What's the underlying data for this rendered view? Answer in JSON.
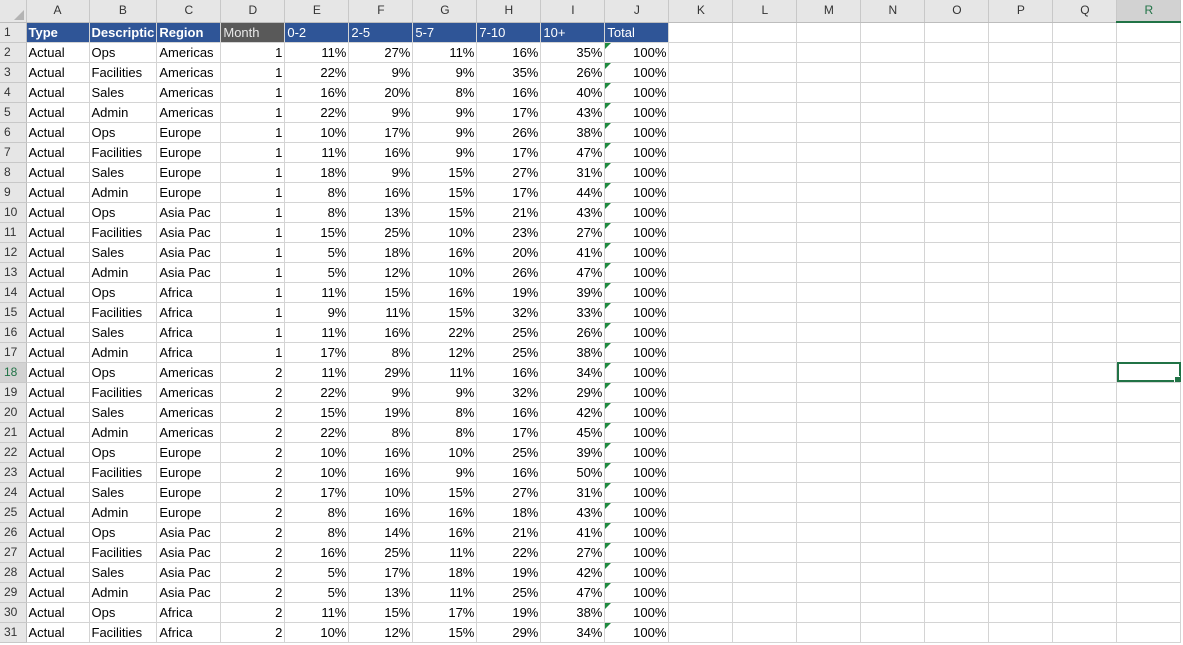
{
  "columns": [
    "A",
    "B",
    "C",
    "D",
    "E",
    "F",
    "G",
    "H",
    "I",
    "J",
    "K",
    "L",
    "M",
    "N",
    "O",
    "P",
    "Q",
    "R"
  ],
  "active_column": "R",
  "active_row": 18,
  "header_row": {
    "type": "Type",
    "description": "Descriptic",
    "region": "Region",
    "month": "Month",
    "b1": "0-2",
    "b2": "2-5",
    "b3": "5-7",
    "b4": "7-10",
    "b5": "10+",
    "total": "Total"
  },
  "rows": [
    {
      "n": "2",
      "type": "Actual",
      "desc": "Ops",
      "region": "Americas",
      "month": "1",
      "b1": "11%",
      "b2": "27%",
      "b3": "11%",
      "b4": "16%",
      "b5": "35%",
      "total": "100%"
    },
    {
      "n": "3",
      "type": "Actual",
      "desc": "Facilities",
      "region": "Americas",
      "month": "1",
      "b1": "22%",
      "b2": "9%",
      "b3": "9%",
      "b4": "35%",
      "b5": "26%",
      "total": "100%"
    },
    {
      "n": "4",
      "type": "Actual",
      "desc": "Sales",
      "region": "Americas",
      "month": "1",
      "b1": "16%",
      "b2": "20%",
      "b3": "8%",
      "b4": "16%",
      "b5": "40%",
      "total": "100%"
    },
    {
      "n": "5",
      "type": "Actual",
      "desc": "Admin",
      "region": "Americas",
      "month": "1",
      "b1": "22%",
      "b2": "9%",
      "b3": "9%",
      "b4": "17%",
      "b5": "43%",
      "total": "100%"
    },
    {
      "n": "6",
      "type": "Actual",
      "desc": "Ops",
      "region": "Europe",
      "month": "1",
      "b1": "10%",
      "b2": "17%",
      "b3": "9%",
      "b4": "26%",
      "b5": "38%",
      "total": "100%"
    },
    {
      "n": "7",
      "type": "Actual",
      "desc": "Facilities",
      "region": "Europe",
      "month": "1",
      "b1": "11%",
      "b2": "16%",
      "b3": "9%",
      "b4": "17%",
      "b5": "47%",
      "total": "100%"
    },
    {
      "n": "8",
      "type": "Actual",
      "desc": "Sales",
      "region": "Europe",
      "month": "1",
      "b1": "18%",
      "b2": "9%",
      "b3": "15%",
      "b4": "27%",
      "b5": "31%",
      "total": "100%"
    },
    {
      "n": "9",
      "type": "Actual",
      "desc": "Admin",
      "region": "Europe",
      "month": "1",
      "b1": "8%",
      "b2": "16%",
      "b3": "15%",
      "b4": "17%",
      "b5": "44%",
      "total": "100%"
    },
    {
      "n": "10",
      "type": "Actual",
      "desc": "Ops",
      "region": "Asia Pac",
      "month": "1",
      "b1": "8%",
      "b2": "13%",
      "b3": "15%",
      "b4": "21%",
      "b5": "43%",
      "total": "100%"
    },
    {
      "n": "11",
      "type": "Actual",
      "desc": "Facilities",
      "region": "Asia Pac",
      "month": "1",
      "b1": "15%",
      "b2": "25%",
      "b3": "10%",
      "b4": "23%",
      "b5": "27%",
      "total": "100%"
    },
    {
      "n": "12",
      "type": "Actual",
      "desc": "Sales",
      "region": "Asia Pac",
      "month": "1",
      "b1": "5%",
      "b2": "18%",
      "b3": "16%",
      "b4": "20%",
      "b5": "41%",
      "total": "100%"
    },
    {
      "n": "13",
      "type": "Actual",
      "desc": "Admin",
      "region": "Asia Pac",
      "month": "1",
      "b1": "5%",
      "b2": "12%",
      "b3": "10%",
      "b4": "26%",
      "b5": "47%",
      "total": "100%"
    },
    {
      "n": "14",
      "type": "Actual",
      "desc": "Ops",
      "region": "Africa",
      "month": "1",
      "b1": "11%",
      "b2": "15%",
      "b3": "16%",
      "b4": "19%",
      "b5": "39%",
      "total": "100%"
    },
    {
      "n": "15",
      "type": "Actual",
      "desc": "Facilities",
      "region": "Africa",
      "month": "1",
      "b1": "9%",
      "b2": "11%",
      "b3": "15%",
      "b4": "32%",
      "b5": "33%",
      "total": "100%"
    },
    {
      "n": "16",
      "type": "Actual",
      "desc": "Sales",
      "region": "Africa",
      "month": "1",
      "b1": "11%",
      "b2": "16%",
      "b3": "22%",
      "b4": "25%",
      "b5": "26%",
      "total": "100%"
    },
    {
      "n": "17",
      "type": "Actual",
      "desc": "Admin",
      "region": "Africa",
      "month": "1",
      "b1": "17%",
      "b2": "8%",
      "b3": "12%",
      "b4": "25%",
      "b5": "38%",
      "total": "100%"
    },
    {
      "n": "18",
      "type": "Actual",
      "desc": "Ops",
      "region": "Americas",
      "month": "2",
      "b1": "11%",
      "b2": "29%",
      "b3": "11%",
      "b4": "16%",
      "b5": "34%",
      "total": "100%"
    },
    {
      "n": "19",
      "type": "Actual",
      "desc": "Facilities",
      "region": "Americas",
      "month": "2",
      "b1": "22%",
      "b2": "9%",
      "b3": "9%",
      "b4": "32%",
      "b5": "29%",
      "total": "100%"
    },
    {
      "n": "20",
      "type": "Actual",
      "desc": "Sales",
      "region": "Americas",
      "month": "2",
      "b1": "15%",
      "b2": "19%",
      "b3": "8%",
      "b4": "16%",
      "b5": "42%",
      "total": "100%"
    },
    {
      "n": "21",
      "type": "Actual",
      "desc": "Admin",
      "region": "Americas",
      "month": "2",
      "b1": "22%",
      "b2": "8%",
      "b3": "8%",
      "b4": "17%",
      "b5": "45%",
      "total": "100%"
    },
    {
      "n": "22",
      "type": "Actual",
      "desc": "Ops",
      "region": "Europe",
      "month": "2",
      "b1": "10%",
      "b2": "16%",
      "b3": "10%",
      "b4": "25%",
      "b5": "39%",
      "total": "100%"
    },
    {
      "n": "23",
      "type": "Actual",
      "desc": "Facilities",
      "region": "Europe",
      "month": "2",
      "b1": "10%",
      "b2": "16%",
      "b3": "9%",
      "b4": "16%",
      "b5": "50%",
      "total": "100%"
    },
    {
      "n": "24",
      "type": "Actual",
      "desc": "Sales",
      "region": "Europe",
      "month": "2",
      "b1": "17%",
      "b2": "10%",
      "b3": "15%",
      "b4": "27%",
      "b5": "31%",
      "total": "100%"
    },
    {
      "n": "25",
      "type": "Actual",
      "desc": "Admin",
      "region": "Europe",
      "month": "2",
      "b1": "8%",
      "b2": "16%",
      "b3": "16%",
      "b4": "18%",
      "b5": "43%",
      "total": "100%"
    },
    {
      "n": "26",
      "type": "Actual",
      "desc": "Ops",
      "region": "Asia Pac",
      "month": "2",
      "b1": "8%",
      "b2": "14%",
      "b3": "16%",
      "b4": "21%",
      "b5": "41%",
      "total": "100%"
    },
    {
      "n": "27",
      "type": "Actual",
      "desc": "Facilities",
      "region": "Asia Pac",
      "month": "2",
      "b1": "16%",
      "b2": "25%",
      "b3": "11%",
      "b4": "22%",
      "b5": "27%",
      "total": "100%"
    },
    {
      "n": "28",
      "type": "Actual",
      "desc": "Sales",
      "region": "Asia Pac",
      "month": "2",
      "b1": "5%",
      "b2": "17%",
      "b3": "18%",
      "b4": "19%",
      "b5": "42%",
      "total": "100%"
    },
    {
      "n": "29",
      "type": "Actual",
      "desc": "Admin",
      "region": "Asia Pac",
      "month": "2",
      "b1": "5%",
      "b2": "13%",
      "b3": "11%",
      "b4": "25%",
      "b5": "47%",
      "total": "100%"
    },
    {
      "n": "30",
      "type": "Actual",
      "desc": "Ops",
      "region": "Africa",
      "month": "2",
      "b1": "11%",
      "b2": "15%",
      "b3": "17%",
      "b4": "19%",
      "b5": "38%",
      "total": "100%"
    },
    {
      "n": "31",
      "type": "Actual",
      "desc": "Facilities",
      "region": "Africa",
      "month": "2",
      "b1": "10%",
      "b2": "12%",
      "b3": "15%",
      "b4": "29%",
      "b5": "34%",
      "total": "100%"
    }
  ],
  "colors": {
    "header_blue": "#2f5597",
    "header_gray": "#595959",
    "selection_green": "#217346",
    "error_flag_green": "#1e8a3e"
  }
}
